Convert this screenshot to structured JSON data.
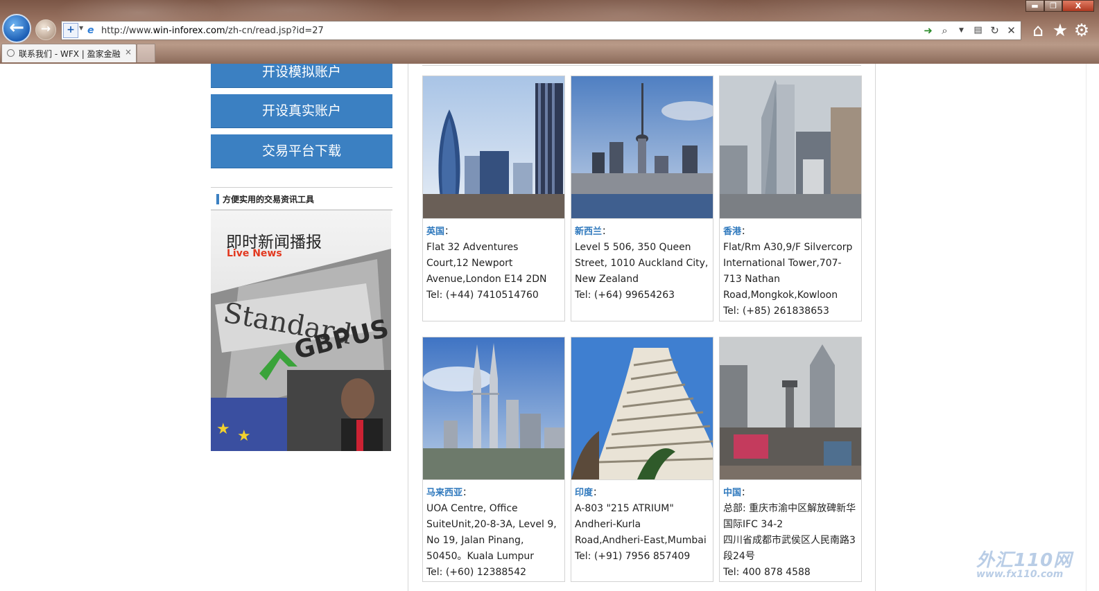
{
  "browser": {
    "address_url": "http://www.win-inforex.com/zh-cn/read.jsp?id=27",
    "address_url_prefix": "http://www.",
    "address_url_domain": "win-inforex.com",
    "address_url_path": "/zh-cn/read.jsp?id=27",
    "tab_title": "联系我们 - WFX | 盈家金融",
    "tab_close": "×",
    "window_min": "▬",
    "window_max": "❐",
    "window_close": "X",
    "back_glyph": "←",
    "forward_glyph": "→",
    "toolbar_icons": [
      "home-icon",
      "star-icon",
      "gear-icon"
    ]
  },
  "sidebar": {
    "buttons": [
      "开设模拟账户",
      "开设真实账户",
      "交易平台下载"
    ],
    "tools_heading": "方便实用的交易资讯工具",
    "banner_title": "即时新闻播报",
    "banner_subtitle": "Live News",
    "banner_photo_text": [
      "Standard",
      "GBPUS"
    ]
  },
  "offices": [
    {
      "country": "英国",
      "lines": [
        "Flat 32 Adventures Court,12 Newport Avenue,London E14 2DN"
      ],
      "tel": "Tel: (+44) 7410514760"
    },
    {
      "country": "新西兰",
      "lines": [
        "Level 5 506, 350 Queen Street, 1010 Auckland City, New Zealand"
      ],
      "tel": "Tel: (+64) 99654263"
    },
    {
      "country": "香港",
      "lines": [
        "Flat/Rm A30,9/F Silvercorp International Tower,707-713 Nathan Road,Mongkok,Kowloon"
      ],
      "tel": "Tel: (+85) 261838653"
    },
    {
      "country": "马来西亚",
      "lines": [
        "UOA Centre, Office SuiteUnit,20-8-3A, Level 9, No 19, Jalan Pinang, 50450。Kuala Lumpur"
      ],
      "tel": "Tel: (+60) 12388542"
    },
    {
      "country": "印度",
      "lines": [
        "A-803 \"215 ATRIUM\" Andheri-Kurla Road,Andheri-East,Mumbai"
      ],
      "tel": "Tel: (+91) 7956 857409"
    },
    {
      "country": "中国",
      "lines": [
        "总部: 重庆市渝中区解放碑新华国际IFC 34-2",
        "四川省成都市武侯区人民南路3段24号"
      ],
      "tel": "Tel: 400 878 4588"
    }
  ],
  "colon": "：",
  "watermark": {
    "big": "外汇110网",
    "small": "www.fx110.com"
  }
}
